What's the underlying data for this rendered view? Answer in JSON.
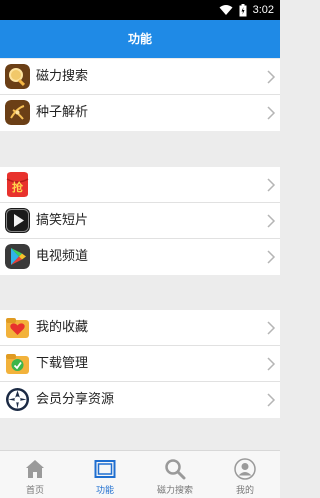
{
  "status_bar": {
    "time": "3:02"
  },
  "header": {
    "title": "功能"
  },
  "groups": [
    {
      "items": [
        {
          "label": "磁力搜索",
          "icon": "magnifier-icon"
        },
        {
          "label": "种子解析",
          "icon": "seed-icon"
        }
      ]
    },
    {
      "items": [
        {
          "label": "",
          "icon": "red-envelope-icon",
          "icon_text": "抢"
        },
        {
          "label": "搞笑短片",
          "icon": "video-play-icon"
        },
        {
          "label": "电视频道",
          "icon": "tv-play-icon"
        }
      ]
    },
    {
      "items": [
        {
          "label": "我的收藏",
          "icon": "heart-folder-icon"
        },
        {
          "label": "下载管理",
          "icon": "download-folder-icon"
        },
        {
          "label": "会员分享资源",
          "icon": "aperture-icon"
        }
      ]
    }
  ],
  "tabs": [
    {
      "label": "首页",
      "icon": "home-icon",
      "active": false
    },
    {
      "label": "功能",
      "icon": "window-icon",
      "active": true
    },
    {
      "label": "磁力搜索",
      "icon": "search-icon",
      "active": false
    },
    {
      "label": "我的",
      "icon": "user-icon",
      "active": false
    }
  ],
  "colors": {
    "header": "#1f8ae6",
    "active_tab": "#1f6fd0"
  }
}
